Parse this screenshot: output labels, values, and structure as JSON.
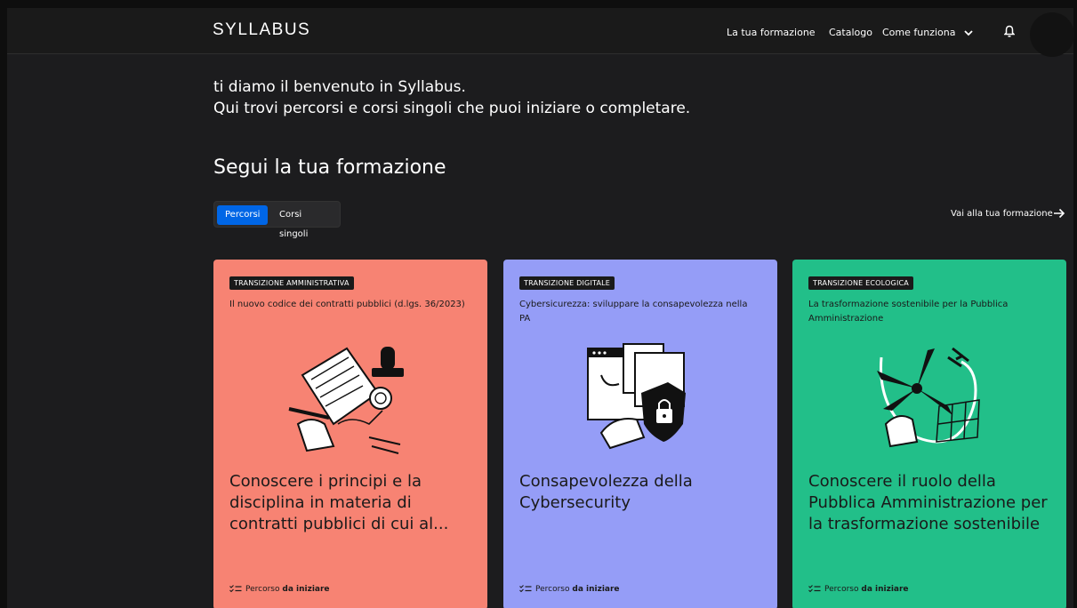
{
  "brand": {
    "logo_text": "SYLLABUS"
  },
  "nav": {
    "links": [
      "La tua formazione",
      "Catalogo",
      "Come funziona"
    ]
  },
  "welcome": {
    "line1": "ti diamo il benvenuto in Syllabus.",
    "line2": "Qui trovi percorsi e corsi singoli che puoi iniziare o completare."
  },
  "section": {
    "title": "Segui la tua formazione",
    "tabs": [
      "Percorsi",
      "Corsi singoli"
    ],
    "go_link": "Vai alla tua formazione"
  },
  "cards": [
    {
      "badge": "TRANSIZIONE AMMINISTRATIVA",
      "subtitle": "Il nuovo codice dei contratti pubblici (d.lgs. 36/2023)",
      "title": "Conoscere i principi e la disciplina in materia di contratti pubblici di cui al...",
      "status_prefix": "Percorso",
      "status_value": "da iniziare",
      "color": "#f78373"
    },
    {
      "badge": "TRANSIZIONE DIGITALE",
      "subtitle": "Cybersicurezza: sviluppare la consapevolezza nella PA",
      "title": "Consapevolezza della Cybersecurity",
      "status_prefix": "Percorso",
      "status_value": "da iniziare",
      "color": "#959df7"
    },
    {
      "badge": "TRANSIZIONE ECOLOGICA",
      "subtitle": "La trasformazione sostenibile per la Pubblica Amministrazione",
      "title": "Conoscere il ruolo della Pubblica Amministrazione per la trasformazione sostenibile",
      "status_prefix": "Percorso",
      "status_value": "da iniziare",
      "color": "#22bf89"
    }
  ],
  "icons": {
    "bell": "bell-icon",
    "chevron": "chevron-down-icon",
    "arrow": "arrow-right-icon",
    "status": "checklist-icon"
  },
  "colors": {
    "background": "#1c1c1e",
    "accent": "#0066e6"
  }
}
